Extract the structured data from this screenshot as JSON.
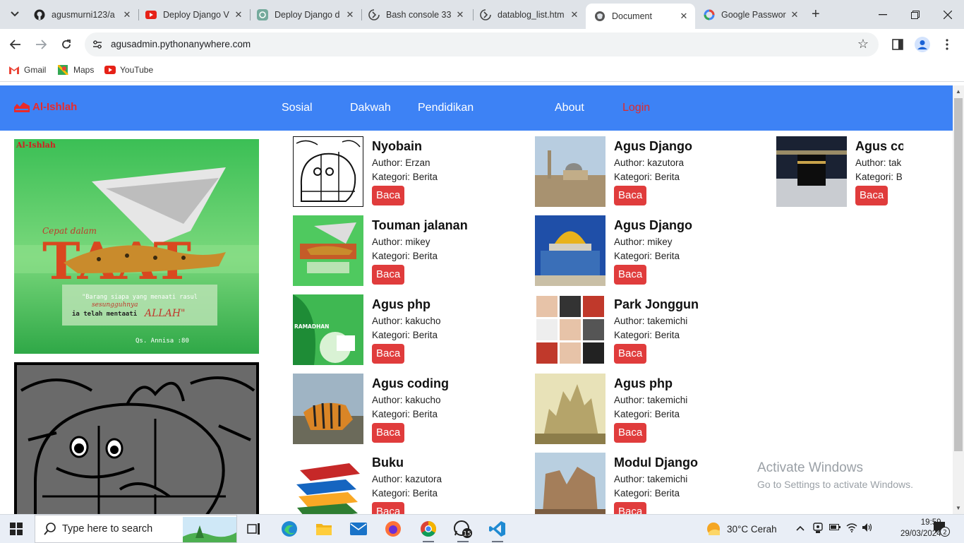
{
  "browser": {
    "tabs": [
      {
        "title": "agusmurni123/a",
        "icon": "github-icon"
      },
      {
        "title": "Deploy Django V",
        "icon": "youtube-icon"
      },
      {
        "title": "Deploy Django d",
        "icon": "chatgpt-icon"
      },
      {
        "title": "Bash console 33",
        "icon": "pythonanywhere-icon"
      },
      {
        "title": "datablog_list.htm",
        "icon": "pythonanywhere-icon"
      },
      {
        "title": "Document",
        "icon": "globe-icon",
        "active": true
      },
      {
        "title": "Google Passwor",
        "icon": "google-icon"
      }
    ],
    "url": "agusadmin.pythonanywhere.com",
    "bookmarks": [
      {
        "label": "Gmail",
        "icon": "gmail-icon"
      },
      {
        "label": "Maps",
        "icon": "maps-icon"
      },
      {
        "label": "YouTube",
        "icon": "youtube-icon"
      }
    ]
  },
  "site": {
    "brand": "Al-Ishlah",
    "menu": {
      "sosial": "Sosial",
      "dakwah": "Dakwah",
      "pendidikan": "Pendidikan",
      "about": "About",
      "login": "Login"
    },
    "colors": {
      "navbar": "#3d82f5",
      "accent": "#e03c3c"
    },
    "poster": {
      "corner_label": "Al-Ishlah",
      "script_heading": "Cepat dalam",
      "big_word": "TAAT",
      "quote_line1": "\"Barang siapa yang menaati rasul",
      "quote_line2": "sesungguhnya",
      "quote_line3": "ia telah mentaati",
      "quote_allah": "ALLAH\"",
      "quote_source": "Qs. Annisa :80"
    },
    "col1": [
      {
        "title": "Nyobain",
        "author": "Author: Erzan",
        "kategori": "Kategori: Berita",
        "baca": "Baca"
      },
      {
        "title": "Touman jalanan",
        "author": "Author: mikey",
        "kategori": "Kategori: Berita",
        "baca": "Baca"
      },
      {
        "title": "Agus php",
        "author": "Author: kakucho",
        "kategori": "Kategori: Berita",
        "baca": "Baca"
      },
      {
        "title": "Agus coding",
        "author": "Author: kakucho",
        "kategori": "Kategori: Berita",
        "baca": "Baca"
      },
      {
        "title": "Buku",
        "author": "Author: kazutora",
        "kategori": "Kategori: Berita",
        "baca": "Baca"
      }
    ],
    "col2": [
      {
        "title": "Agus Django",
        "author": "Author: kazutora",
        "kategori": "Kategori: Berita",
        "baca": "Baca"
      },
      {
        "title": "Agus Django",
        "author": "Author: mikey",
        "kategori": "Kategori: Berita",
        "baca": "Baca"
      },
      {
        "title": "Park Jonggun",
        "author": "Author: takemichi",
        "kategori": "Kategori: Berita",
        "baca": "Baca"
      },
      {
        "title": "Agus php",
        "author": "Author: takemichi",
        "kategori": "Kategori: Berita",
        "baca": "Baca"
      },
      {
        "title": "Modul Django",
        "author": "Author: takemichi",
        "kategori": "Kategori: Berita",
        "baca": "Baca"
      }
    ],
    "col3": [
      {
        "title": "Agus co",
        "author": "Author: tak",
        "kategori": "Kategori: B",
        "baca": "Baca"
      }
    ],
    "ramadhan_thumb_label": "RAMADHAN"
  },
  "watermark": {
    "line1": "Activate Windows",
    "line2": "Go to Settings to activate Windows."
  },
  "taskbar": {
    "search_placeholder": "Type here to search",
    "whatsapp_badge": "15",
    "weather": "30°C  Cerah",
    "time": "19:59",
    "date": "29/03/2024",
    "notification_count": "2"
  }
}
